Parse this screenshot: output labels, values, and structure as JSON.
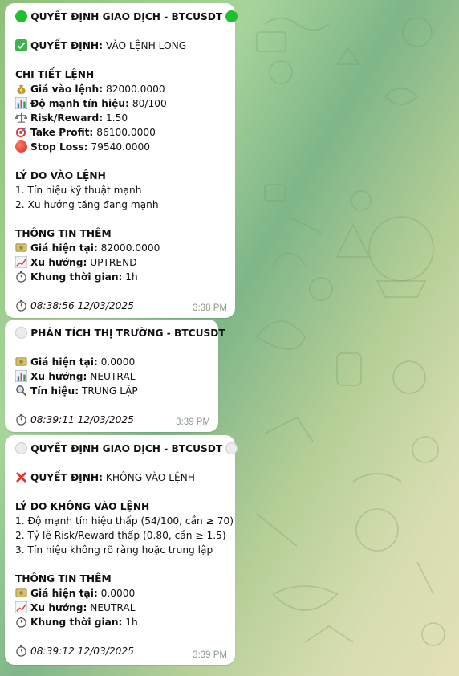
{
  "messages": [
    {
      "title": "QUYẾT ĐỊNH GIAO DỊCH - BTCUSDT",
      "title_icon_color": "#1fbf2e",
      "decision_label": "QUYẾT ĐỊNH:",
      "decision_value": "VÀO LỆNH LONG",
      "decision_icon": "check-icon",
      "details_heading": "CHI TIẾT LỆNH",
      "details": [
        {
          "icon": "money-bag-icon",
          "label": "Giá vào lệnh:",
          "value": "82000.0000"
        },
        {
          "icon": "bar-chart-icon",
          "label": "Độ mạnh tín hiệu:",
          "value": "80/100"
        },
        {
          "icon": "scales-icon",
          "label": "Risk/Reward:",
          "value": "1.50"
        },
        {
          "icon": "target-icon",
          "label": "Take Profit:",
          "value": "86100.0000"
        },
        {
          "icon": "red-circle-icon",
          "label": "Stop Loss:",
          "value": "79540.0000"
        }
      ],
      "reasons_heading": "LÝ DO VÀO LỆNH",
      "reasons": [
        "1. Tín hiệu kỹ thuật mạnh",
        "2. Xu hướng tăng đang mạnh"
      ],
      "extra_heading": "THÔNG TIN THÊM",
      "extra": [
        {
          "icon": "banknote-icon",
          "label": "Giá hiện tại:",
          "value": "82000.0000"
        },
        {
          "icon": "trend-up-icon",
          "label": "Xu hướng:",
          "value": "UPTREND"
        },
        {
          "icon": "stopwatch-icon",
          "label": "Khung thời gian:",
          "value": "1h"
        }
      ],
      "timestamp": "08:38:56 12/03/2025",
      "time": "3:38 PM"
    },
    {
      "title": "PHÂN TÍCH THỊ TRƯỜNG - BTCUSDT",
      "title_icon_color": "#e6e6e6",
      "lines": [
        {
          "icon": "banknote-icon",
          "label": "Giá hiện tại:",
          "value": "0.0000"
        },
        {
          "icon": "bar-chart-icon",
          "label": "Xu hướng:",
          "value": "NEUTRAL"
        },
        {
          "icon": "magnifier-icon",
          "label": "Tín hiệu:",
          "value": "TRUNG LẬP"
        }
      ],
      "timestamp": "08:39:11 12/03/2025",
      "time": "3:39 PM"
    },
    {
      "title": "QUYẾT ĐỊNH GIAO DỊCH - BTCUSDT",
      "title_icon_color": "#e6e6e6",
      "decision_label": "QUYẾT ĐỊNH:",
      "decision_value": "KHÔNG VÀO LỆNH",
      "decision_icon": "cross-icon",
      "reasons_heading": "LÝ DO KHÔNG VÀO LỆNH",
      "reasons": [
        "1. Độ mạnh tín hiệu thấp (54/100, cần ≥ 70)",
        "2. Tỷ lệ Risk/Reward thấp (0.80, cần ≥ 1.5)",
        "3. Tín hiệu không rõ ràng hoặc trung lập"
      ],
      "extra_heading": "THÔNG TIN THÊM",
      "extra": [
        {
          "icon": "banknote-icon",
          "label": "Giá hiện tại:",
          "value": "0.0000"
        },
        {
          "icon": "trend-up-icon",
          "label": "Xu hướng:",
          "value": "NEUTRAL"
        },
        {
          "icon": "stopwatch-icon",
          "label": "Khung thời gian:",
          "value": "1h"
        }
      ],
      "timestamp": "08:39:12 12/03/2025",
      "time": "3:39 PM"
    }
  ]
}
